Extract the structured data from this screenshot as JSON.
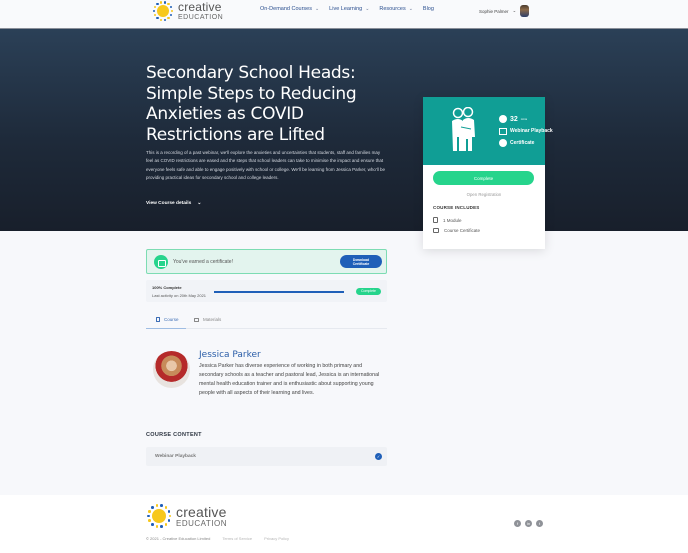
{
  "header": {
    "logo_line1": "creative",
    "logo_line2": "EDUCATION",
    "nav": [
      {
        "label": "On-Demand Courses",
        "has_dropdown": true
      },
      {
        "label": "Live Learning",
        "has_dropdown": true
      },
      {
        "label": "Resources",
        "has_dropdown": true
      },
      {
        "label": "Blog",
        "has_dropdown": false
      }
    ],
    "user_name": "Sophie Palmer",
    "chevron": "⌄"
  },
  "hero": {
    "title": "Secondary School Heads: Simple Steps to Reducing Anxieties as COVID Restrictions are Lifted",
    "description": "This is a recording of a past webinar, we'll explore the anxieties and uncertainties that students, staff and families may feel as COVID restrictions are eased and the steps that school leaders can take to minimise the impact and ensure that everyone feels safe and able to engage positively with school or college. We'll be learning from Jessica Parker, who'll be providing practical ideas for secondary school and college leaders.",
    "view_details_label": "View Course details",
    "view_details_icon": "⌄"
  },
  "card": {
    "duration_value": "32",
    "duration_unit": "mins",
    "format": "Webinar Playback",
    "certificate": "Certificate",
    "complete_button": "Complete",
    "registration_status": "Open Registration",
    "includes_heading": "COURSE INCLUDES",
    "includes": [
      "1 Module",
      "Course Certificate"
    ],
    "accent_color": "#109e95"
  },
  "certificate_banner": {
    "text": "You've earned a certificate!",
    "button_line1": "Download",
    "button_line2": "Certificate"
  },
  "progress": {
    "title": "100% Complete",
    "last_activity": "Last activity on 20th May 2021",
    "percent": 100,
    "badge": "Complete"
  },
  "tabs": [
    {
      "label": "Course",
      "active": true
    },
    {
      "label": "Materials",
      "active": false
    }
  ],
  "instructor": {
    "name": "Jessica Parker",
    "bio": "Jessica Parker has diverse experience of working in both primary and secondary schools as a teacher and pastoral lead, Jessica is an international mental health education trainer and is enthusiastic about supporting young people with all aspects of their learning and lives."
  },
  "course_content": {
    "heading": "COURSE CONTENT",
    "items": [
      {
        "label": "Webinar Playback",
        "completed": true,
        "check_icon": "✓"
      }
    ]
  },
  "footer": {
    "logo_line1": "creative",
    "logo_line2": "EDUCATION",
    "copyright": "© 2021 - Creative Education Limited",
    "links": [
      "Terms of Service",
      "Privacy Policy"
    ],
    "social": [
      {
        "name": "facebook",
        "glyph": "f"
      },
      {
        "name": "linkedin",
        "glyph": "in"
      },
      {
        "name": "twitter",
        "glyph": "t"
      }
    ]
  },
  "colors": {
    "primary_blue": "#1f5fb8",
    "success_green": "#26d48c",
    "teal": "#109e95",
    "sun_yellow": "#f7c81c"
  }
}
